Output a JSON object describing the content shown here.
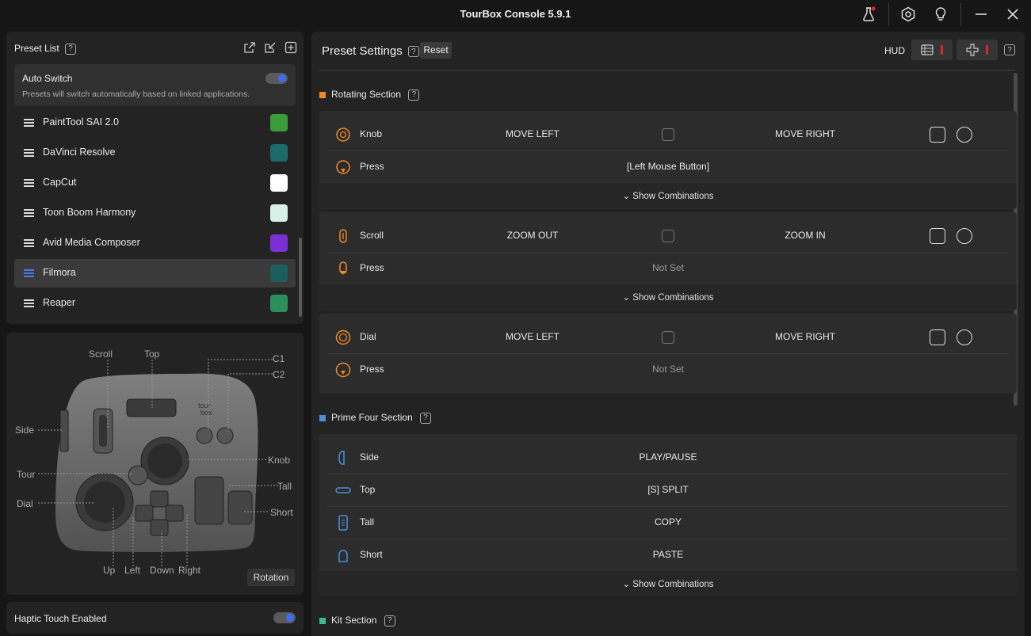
{
  "app": {
    "title": "TourBox Console 5.9.1"
  },
  "sidebar": {
    "preset_list_label": "Preset List",
    "auto_switch": {
      "title": "Auto Switch",
      "subtitle": "Presets will switch automatically based on linked applications.",
      "enabled": true
    },
    "presets": [
      {
        "name": "PaintTool SAI 2.0",
        "icon": "painttool-sai-icon",
        "color": "#3a9d3a",
        "active": false
      },
      {
        "name": "DaVinci Resolve",
        "icon": "davinci-resolve-icon",
        "color": "#1c6a6a",
        "active": false
      },
      {
        "name": "CapCut",
        "icon": "capcut-icon",
        "color": "#ffffff",
        "active": false
      },
      {
        "name": "Toon Boom Harmony",
        "icon": "toon-boom-harmony-icon",
        "color": "#d8f0e8",
        "active": false
      },
      {
        "name": "Avid Media Composer",
        "icon": "avid-media-composer-icon",
        "color": "#7b2fd4",
        "active": false
      },
      {
        "name": "Filmora",
        "icon": "filmora-icon",
        "color": "#1b5e5e",
        "active": true
      },
      {
        "name": "Reaper",
        "icon": "reaper-icon",
        "color": "#2b8f5c",
        "active": false
      }
    ]
  },
  "device": {
    "labels": {
      "scroll": "Scroll",
      "top": "Top",
      "c1": "C1",
      "c2": "C2",
      "side": "Side",
      "knob": "Knob",
      "tour": "Tour",
      "tall": "Tall",
      "dial": "Dial",
      "short": "Short",
      "up": "Up",
      "left": "Left",
      "down": "Down",
      "right": "Right"
    },
    "rotation_button": "Rotation"
  },
  "haptic": {
    "label": "Haptic Touch Enabled",
    "enabled": true
  },
  "main": {
    "title": "Preset Settings",
    "reset_label": "Reset",
    "hud_label": "HUD",
    "sections": {
      "rotating": {
        "title": "Rotating Section",
        "color": "#f08a24"
      },
      "prime_four": {
        "title": "Prime Four Section",
        "color": "#4a90d9"
      },
      "kit": {
        "title": "Kit Section",
        "color": "#3cb88a"
      }
    },
    "knob": {
      "label": "Knob",
      "left": "MOVE LEFT",
      "right": "MOVE RIGHT",
      "press_label": "Press",
      "press_value": "[Left Mouse Button]"
    },
    "scroll": {
      "label": "Scroll",
      "left": "ZOOM OUT",
      "right": "ZOOM IN",
      "press_label": "Press",
      "press_value": "Not Set"
    },
    "dial": {
      "label": "Dial",
      "left": "MOVE LEFT",
      "right": "MOVE RIGHT",
      "press_label": "Press",
      "press_value": "Not Set"
    },
    "prime": [
      {
        "label": "Side",
        "value": "PLAY/PAUSE",
        "icon": "side-button-icon"
      },
      {
        "label": "Top",
        "value": "[S] SPLIT",
        "icon": "top-button-icon"
      },
      {
        "label": "Tall",
        "value": "COPY",
        "icon": "tall-button-icon"
      },
      {
        "label": "Short",
        "value": "PASTE",
        "icon": "short-button-icon"
      }
    ],
    "show_combinations": "Show Combinations"
  }
}
